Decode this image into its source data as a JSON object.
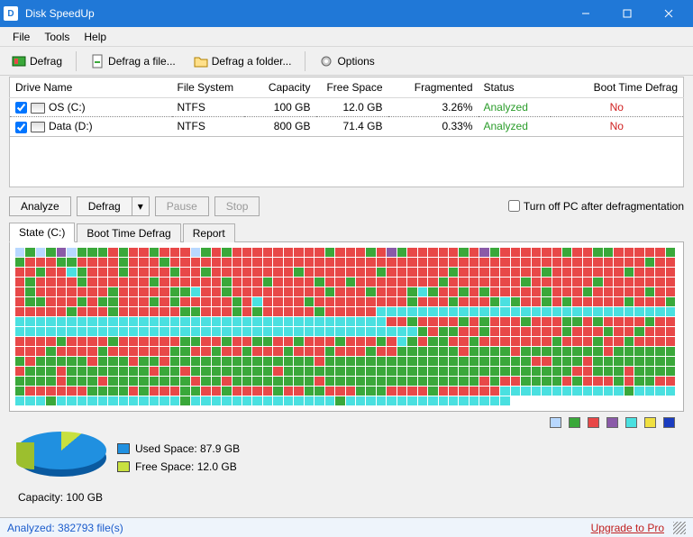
{
  "window": {
    "title": "Disk SpeedUp"
  },
  "menu": {
    "file": "File",
    "tools": "Tools",
    "help": "Help"
  },
  "toolbar": {
    "defrag": "Defrag",
    "defrag_file": "Defrag a file...",
    "defrag_folder": "Defrag a folder...",
    "options": "Options"
  },
  "table": {
    "headers": {
      "drive": "Drive Name",
      "fs": "File System",
      "capacity": "Capacity",
      "free": "Free Space",
      "fragmented": "Fragmented",
      "status": "Status",
      "boot": "Boot Time Defrag"
    },
    "rows": [
      {
        "name": "OS (C:)",
        "fs": "NTFS",
        "capacity": "100 GB",
        "free": "12.0 GB",
        "fragmented": "3.26%",
        "status": "Analyzed",
        "boot": "No"
      },
      {
        "name": "Data (D:)",
        "fs": "NTFS",
        "capacity": "800 GB",
        "free": "71.4 GB",
        "fragmented": "0.33%",
        "status": "Analyzed",
        "boot": "No"
      }
    ]
  },
  "actions": {
    "analyze": "Analyze",
    "defrag": "Defrag",
    "pause": "Pause",
    "stop": "Stop",
    "turn_off": "Turn off PC after defragmentation"
  },
  "tabs": {
    "state": "State (C:)",
    "boot": "Boot Time Defrag",
    "report": "Report"
  },
  "legend_colors": [
    "#b8d8ff",
    "#3aa83a",
    "#e84848",
    "#8a5aa8",
    "#4ae0e0",
    "#f0e040",
    "#1a3cc0"
  ],
  "pie": {
    "used_label": "Used Space: 87.9 GB",
    "free_label": "Free Space: 12.0 GB",
    "used_color": "#2090e0",
    "free_color": "#c8e040"
  },
  "capacity_line": "Capacity: 100 GB",
  "status": {
    "analyzed": "Analyzed: 382793 file(s)",
    "upgrade": "Upgrade to Pro"
  },
  "cluster_pattern": "bgbgpbgggrgrrgrrrbgrgrrrrrrrrrgrrrgrpgrrrrrgrpgrrrrrrgrrggrrrrrggrrrggrrrrgrrrgrrrrrrrrrrrrrrrrrrrrrrrrrrrrrrrrrrrrrrrrrrrrrrgrrrrgrrcgrrrgrrrrgrrgrrrrrrrrgrrrrrrrgrrrrrrgrrrrrrrrgrrrrrrrgrrrrrgrrrrgrrrrrrgrrrrrrgrrrgrrrrgrrgrrrrrrrrgrrrrrrrgrrrrrrgrrrrrrrrgrrrrrrrgrrrrrggcrrgrrrrrrrrrgrrrgrrrgcgrrgrgrrrrrgrrrgrrrrrgrrrggrrrgrggrrrgrgrrrrrgrcrrrrgrrrrrrrrrgrrrgrrrgcgrrgrgrrrrrgrrrgrrrrrgrrrgrrrrrrggrrrgrgrrrrrgrrrrrcccccccccccccccccccccccccccccccccccccccccccccccccccccccccccccccccrrgrrrrgrgrrrgrrrggrgrrrrgrrcccccccccccccccccccccccccccccccccccccccgrggrrgrrrrrrrgrrrgrrgrrrrrrrgrrrrgrrrrrrggrrgrrggrrgrrrgrrrgrcgrggrrgrrrrrrrgrrrgrrgrrrrrrrgrrrrgrrrrrrggrrgrrgrrrgrrrgrrrgrrggggggrggggrggggggggrgggggggrgggggrgggrggrggggggggggggggrggggggggggggggggggggrrgggrggggggggrgggrggggggggrggrggggggggrggggggggggggggggggggggggggggrrgggrggggggggrgggrggggggggrggrggggggggrgggggggggggggggrgrrggggrgrrrgrggrrgrrrrrrggggrgrrrggrrgrrrrgrrggrrrgggrrrrgrrrrrrccccccccccccgcccccccgccccccccccccgccccccccccccccgcccccccccccccccc"
}
